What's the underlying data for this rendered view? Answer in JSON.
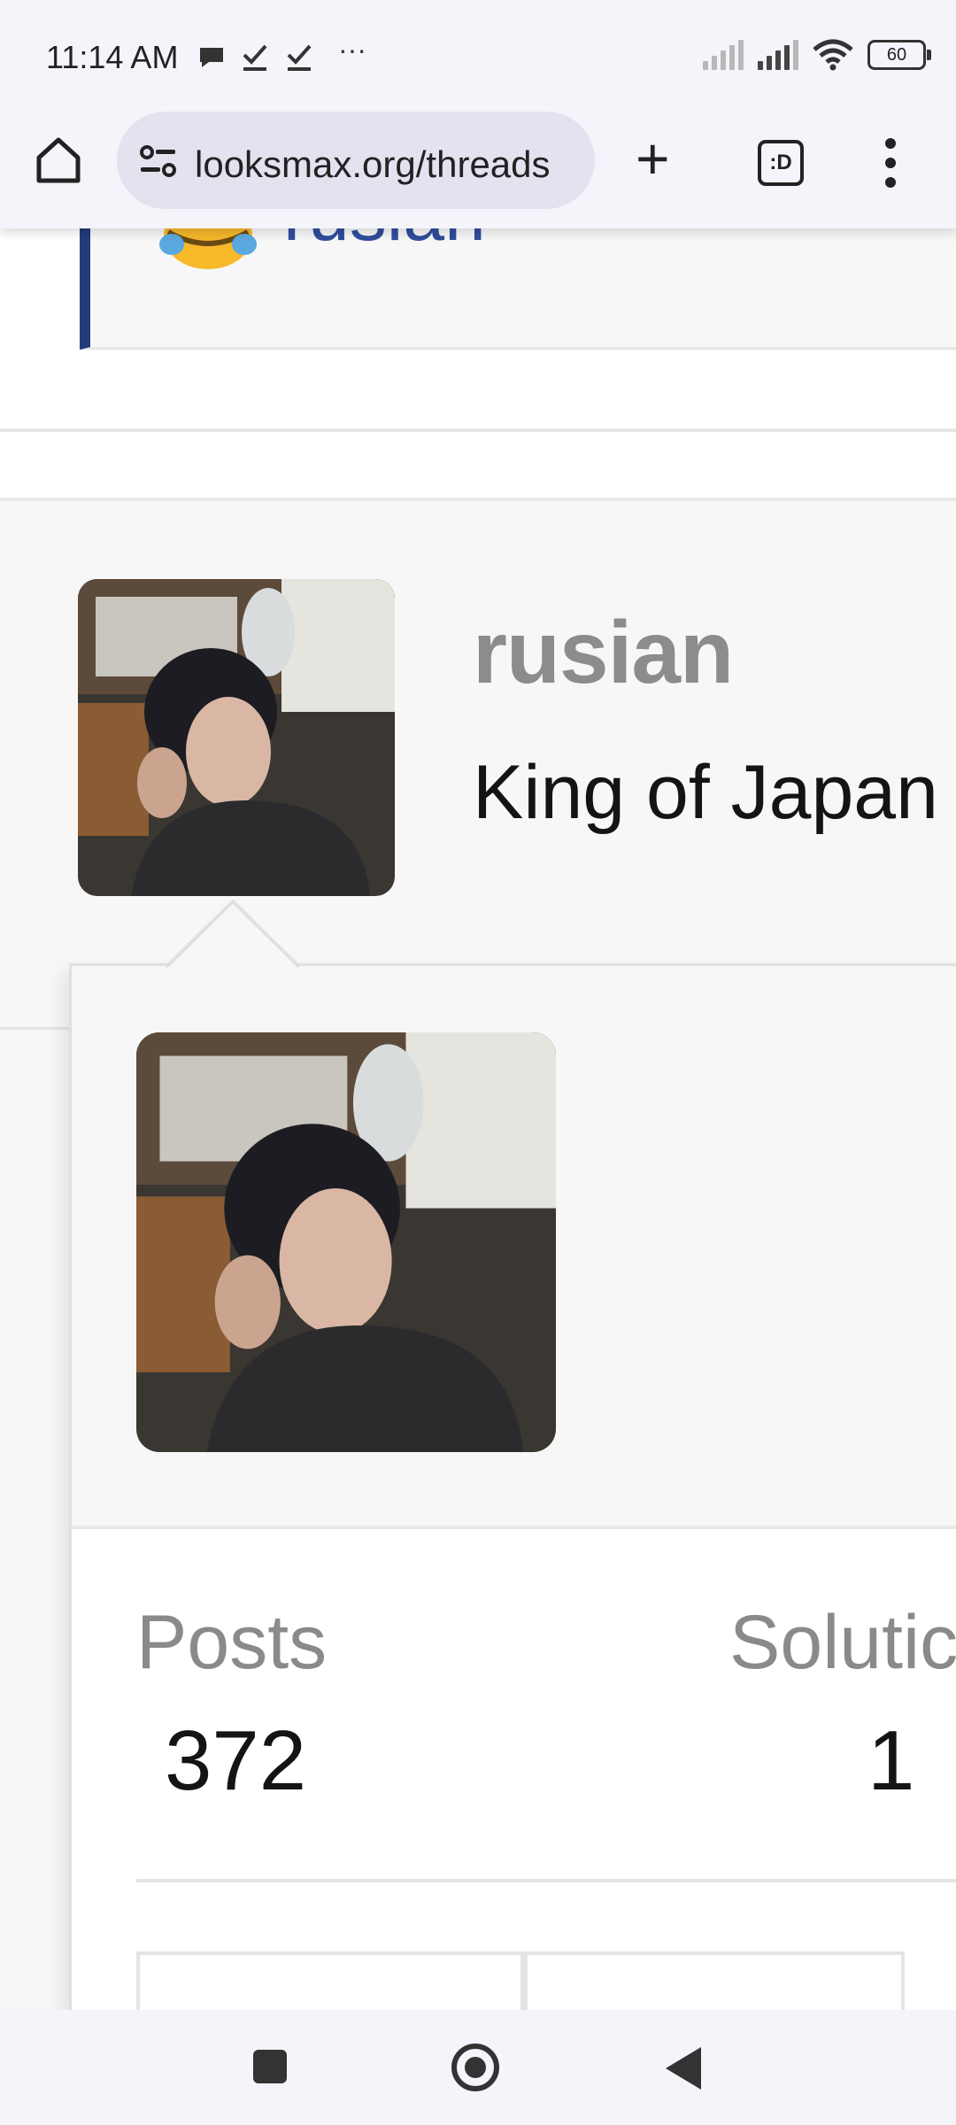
{
  "status_bar": {
    "time": "11:14 AM",
    "notification_icons": [
      "chat-bubble-icon",
      "check-icon",
      "check-icon",
      "more-dots-icon"
    ],
    "battery_level": "60"
  },
  "browser": {
    "url": "looksmax.org/threads",
    "tab_count_label": ":D"
  },
  "quote": {
    "name": "rusian"
  },
  "profile": {
    "username": "rusian",
    "title": "King of Japan"
  },
  "popup": {
    "stats": [
      {
        "label": "Posts",
        "value": "372"
      },
      {
        "label": "Solutic",
        "value": "1"
      }
    ]
  },
  "colors": {
    "quote_border": "#243b7a",
    "link_blue": "#2f4d9b",
    "username_gray": "#8c8c8c"
  }
}
